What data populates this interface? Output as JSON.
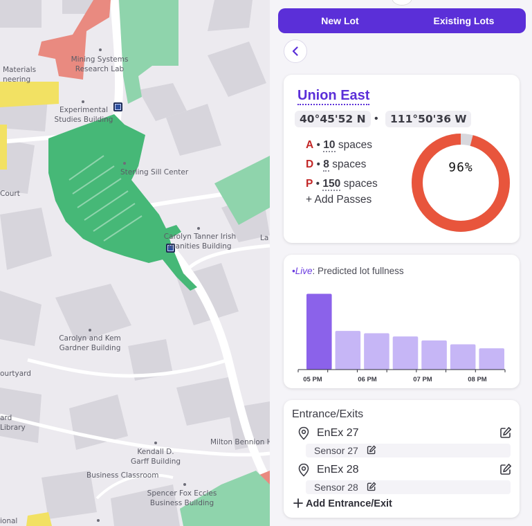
{
  "tabs": {
    "new_lot": "New Lot",
    "existing_lots": "Existing Lots"
  },
  "lot": {
    "name": "Union East",
    "lat": "40°45'52 N",
    "lon": "111°50'36 W",
    "separator": "•",
    "passes": [
      {
        "code": "A",
        "dot": "•",
        "count": "10",
        "unit": "spaces"
      },
      {
        "code": "D",
        "dot": "•",
        "count": "8",
        "unit": "spaces"
      },
      {
        "code": "P",
        "dot": "•",
        "count": "150",
        "unit": "spaces"
      }
    ],
    "add_passes": "+ Add Passes",
    "fullness_text": "96%",
    "fullness_value": 96,
    "colors": {
      "fill": "#e8553c",
      "track": "#d8d7dc"
    }
  },
  "live": {
    "prefix": "•Live",
    "colon": ":",
    "label": "Predicted lot fullness"
  },
  "chart_data": {
    "type": "bar",
    "title": "",
    "xlabel": "",
    "ylabel": "",
    "ylim": [
      0,
      100
    ],
    "tick_labels": [
      "05 PM",
      "06 PM",
      "07 PM",
      "08 PM"
    ],
    "values": [
      96,
      49,
      46,
      42,
      37,
      32,
      27
    ],
    "highlight_index": 0,
    "colors": {
      "highlight": "#8b62ea",
      "normal": "#c6b6f6"
    },
    "grid": false
  },
  "enex": {
    "title": "Entrance/Exits",
    "items": [
      {
        "name": "EnEx 27",
        "sensor": "Sensor 27"
      },
      {
        "name": "EnEx 28",
        "sensor": "Sensor 28"
      }
    ],
    "add_label": "Add Entrance/Exit"
  },
  "map": {
    "labels": [
      {
        "id": "mining",
        "lines": [
          "Mining Systems",
          "Research Lab"
        ]
      },
      {
        "id": "materials",
        "lines": [
          "Materials",
          "neering"
        ]
      },
      {
        "id": "experimental",
        "lines": [
          "Experimental",
          "Studies Building"
        ]
      },
      {
        "id": "sterling",
        "lines": [
          "Sterling Sill Center"
        ]
      },
      {
        "id": "court",
        "lines": [
          "Court"
        ]
      },
      {
        "id": "tanner",
        "lines": [
          "Carolyn Tanner Irish",
          "manities Building"
        ]
      },
      {
        "id": "la",
        "lines": [
          "La"
        ]
      },
      {
        "id": "gardner",
        "lines": [
          "Carolyn and Kem",
          "Gardner Building"
        ]
      },
      {
        "id": "courtyard",
        "lines": [
          "ourtyard"
        ]
      },
      {
        "id": "library",
        "lines": [
          "ard",
          "Library"
        ]
      },
      {
        "id": "bennion",
        "lines": [
          "Milton Bennion H"
        ]
      },
      {
        "id": "garff",
        "lines": [
          "Kendall D.",
          "Garff Building"
        ]
      },
      {
        "id": "classroom",
        "lines": [
          "Business Classroom"
        ]
      },
      {
        "id": "eccles",
        "lines": [
          "Spencer Fox Eccles",
          "Business Building"
        ]
      },
      {
        "id": "ional",
        "lines": [
          "ional"
        ]
      }
    ],
    "colors": {
      "lot": "#46b877",
      "lot_light": "#8fd4ac",
      "building": "#d7d5dc",
      "road": "#ffffff",
      "red_zone": "#e98a80",
      "yellow_zone": "#f2e163"
    }
  }
}
